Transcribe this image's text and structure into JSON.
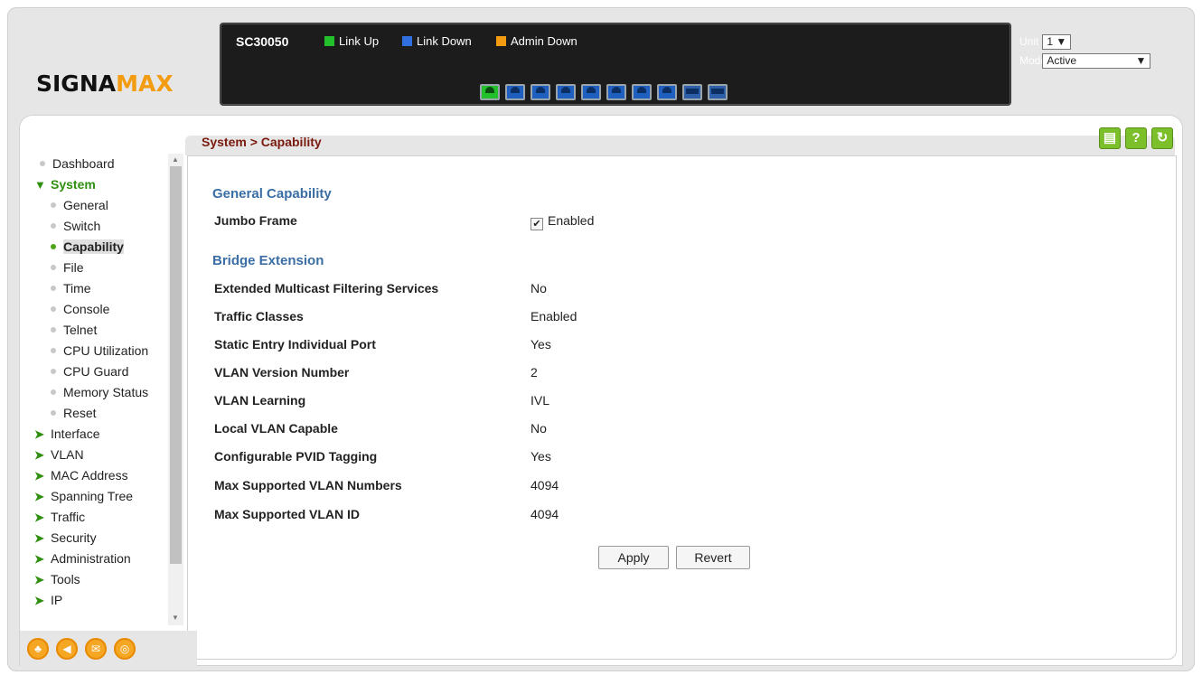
{
  "header": {
    "logo_main": "SIGNA",
    "logo_accent": "MAX",
    "model": "SC30050",
    "legend": [
      {
        "label": "Link Up",
        "color": "#22c02a"
      },
      {
        "label": "Link Down",
        "color": "#2f6fe0"
      },
      {
        "label": "Admin Down",
        "color": "#f39c12"
      }
    ],
    "ports": [
      "up",
      "down",
      "down",
      "down",
      "down",
      "down",
      "down",
      "down",
      "sfp",
      "sfp"
    ],
    "unit_label": "Unit",
    "unit_value": "1 ▼",
    "mode_label": "Mode",
    "mode_value": "Active"
  },
  "page": {
    "breadcrumb": "System > Capability",
    "toolbar": {
      "save": "save-icon",
      "help": "help-icon",
      "refresh": "refresh-icon"
    }
  },
  "sidebar": {
    "items": [
      {
        "label": "Dashboard"
      },
      {
        "label": "System"
      },
      {
        "label": "General"
      },
      {
        "label": "Switch"
      },
      {
        "label": "Capability"
      },
      {
        "label": "File"
      },
      {
        "label": "Time"
      },
      {
        "label": "Console"
      },
      {
        "label": "Telnet"
      },
      {
        "label": "CPU Utilization"
      },
      {
        "label": "CPU Guard"
      },
      {
        "label": "Memory Status"
      },
      {
        "label": "Reset"
      },
      {
        "label": "Interface"
      },
      {
        "label": "VLAN"
      },
      {
        "label": "MAC Address"
      },
      {
        "label": "Spanning Tree"
      },
      {
        "label": "Traffic"
      },
      {
        "label": "Security"
      },
      {
        "label": "Administration"
      },
      {
        "label": "Tools"
      },
      {
        "label": "IP"
      }
    ]
  },
  "form": {
    "general_heading": "General Capability",
    "jumbo_label": "Jumbo Frame",
    "jumbo_value": "Enabled",
    "bridge_heading": "Bridge Extension",
    "rows": [
      {
        "label": "Extended Multicast Filtering Services",
        "value": "No"
      },
      {
        "label": "Traffic Classes",
        "value": "Enabled"
      },
      {
        "label": "Static Entry Individual Port",
        "value": "Yes"
      },
      {
        "label": "VLAN Version Number",
        "value": "2"
      },
      {
        "label": "VLAN Learning",
        "value": "IVL"
      },
      {
        "label": "Local VLAN Capable",
        "value": "No"
      },
      {
        "label": "Configurable PVID Tagging",
        "value": "Yes"
      },
      {
        "label": "Max Supported VLAN Numbers",
        "value": "4094"
      },
      {
        "label": "Max Supported VLAN ID",
        "value": "4094"
      }
    ],
    "apply_label": "Apply",
    "revert_label": "Revert"
  }
}
